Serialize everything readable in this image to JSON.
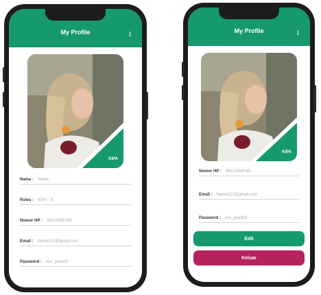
{
  "colors": {
    "accent": "#16996c",
    "logout": "#b5225f"
  },
  "left_screen": {
    "header": {
      "title": "My Profile",
      "menu_icon": "dots-vertical-icon",
      "menu_glyph": "⁝"
    },
    "photo": {
      "badge": "KIPA"
    },
    "fields": [
      {
        "label": "Name :",
        "value": "Name"
      },
      {
        "label": "Roles :",
        "value": "KIPA - X"
      },
      {
        "label": "Nomor HP :",
        "value": "08123456789"
      },
      {
        "label": "Email :",
        "value": "Name123@gmail.com"
      },
      {
        "label": "Password :",
        "value": "kes_pass03"
      }
    ]
  },
  "right_screen": {
    "header": {
      "title": "My Profile",
      "menu_icon": "dots-vertical-icon",
      "menu_glyph": "⁝"
    },
    "photo": {
      "badge": "KIPA"
    },
    "fields": [
      {
        "label": "Nomor HP :",
        "value": "08123456789"
      },
      {
        "label": "Email :",
        "value": "Name123@gmail.com"
      },
      {
        "label": "Password :",
        "value": "kes_pass03"
      }
    ],
    "edit_button": "Edit",
    "logout_button": "Keluar"
  }
}
